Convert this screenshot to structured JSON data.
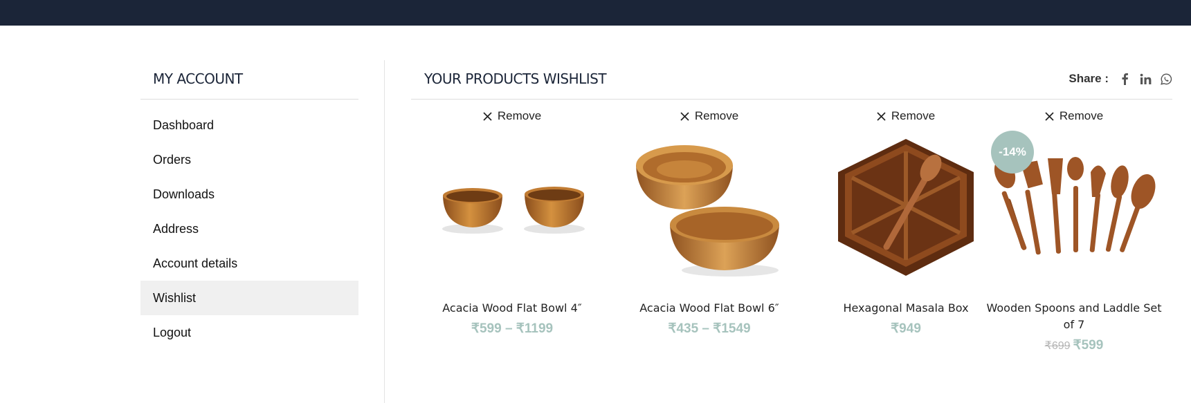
{
  "sidebar": {
    "title": "MY ACCOUNT",
    "items": [
      {
        "label": "Dashboard"
      },
      {
        "label": "Orders"
      },
      {
        "label": "Downloads"
      },
      {
        "label": "Address"
      },
      {
        "label": "Account details"
      },
      {
        "label": "Wishlist",
        "active": true
      },
      {
        "label": "Logout"
      }
    ]
  },
  "main": {
    "title": "YOUR PRODUCTS WISHLIST",
    "share_label": "Share :",
    "share_icons": [
      "facebook-icon",
      "linkedin-icon",
      "whatsapp-icon"
    ]
  },
  "products": [
    {
      "remove_label": "Remove",
      "name": "Acacia Wood Flat Bowl 4″",
      "price": "₹599 – ₹1199",
      "image": "two-small-wooden-bowls"
    },
    {
      "remove_label": "Remove",
      "name": "Acacia Wood Flat Bowl 6″",
      "price": "₹435 – ₹1549",
      "image": "two-stacked-wooden-bowls"
    },
    {
      "remove_label": "Remove",
      "name": "Hexagonal Masala Box",
      "price": "₹949",
      "image": "hexagonal-wooden-spice-box"
    },
    {
      "remove_label": "Remove",
      "name": "Wooden Spoons and Laddle Set of 7",
      "old_price": "₹699",
      "price": "₹599",
      "badge": "-14%",
      "image": "wooden-spoon-set"
    }
  ],
  "colors": {
    "topbar": "#1b2538",
    "accent_price": "#a6c3bd",
    "active_item_bg": "#f0f0f0"
  }
}
